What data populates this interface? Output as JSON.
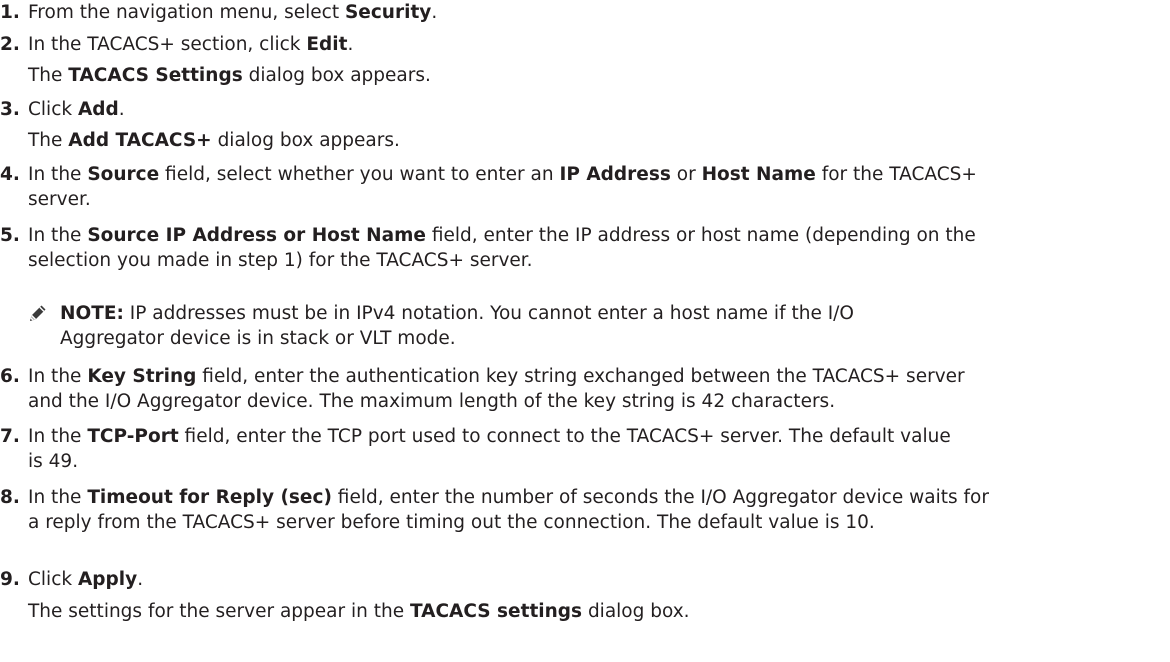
{
  "steps": [
    {
      "num": "1.",
      "t1": "From the navigation menu, select ",
      "b1": "Security",
      "t2": "."
    },
    {
      "num": "2.",
      "t1": "In the TACACS+ section, click ",
      "b1": "Edit",
      "t2": "."
    },
    {
      "num": "3.",
      "t1": "Click ",
      "b1": "Add",
      "t2": "."
    },
    {
      "num": "4.",
      "t1": "In the ",
      "b1": "Source",
      "t2": " field, select whether you want to enter an ",
      "b2": "IP Address",
      "t3": " or ",
      "b3": "Host Name",
      "t4": " for the TACACS+",
      "t5": "server."
    },
    {
      "num": "5.",
      "t1": "In the ",
      "b1": "Source IP Address or Host Name",
      "t2": " field, enter the IP address or host name (depending on the",
      "t3": "selection you made in step 1) for the TACACS+ server."
    },
    {
      "num": "6.",
      "t1": "In the ",
      "b1": "Key String",
      "t2": " field, enter the authentication key string exchanged between the TACACS+ server",
      "t3": "and the I/O Aggregator device. The maximum length of the key string is 42 characters."
    },
    {
      "num": "7.",
      "t1": "In the ",
      "b1": "TCP-Port",
      "t2": " field, enter the TCP port used to connect to the TACACS+ server. The default value",
      "t3": "is 49."
    },
    {
      "num": "8.",
      "t1": "In the ",
      "b1": "Timeout for Reply (sec)",
      "t2": " field, enter the number of seconds the I/O Aggregator device waits for",
      "t3": "a reply from the TACACS+ server before timing out the connection. The default value is 10."
    },
    {
      "num": "9.",
      "t1": "Click ",
      "b1": "Apply",
      "t2": "."
    }
  ],
  "results": {
    "r2": {
      "t1": "The ",
      "b1": "TACACS Settings",
      "t2": " dialog box appears."
    },
    "r3": {
      "t1": "The ",
      "b1": "Add TACACS+",
      "t2": " dialog box appears."
    },
    "r9": {
      "t1": "The settings for the server appear in the ",
      "b1": "TACACS settings",
      "t2": " dialog box."
    }
  },
  "note": {
    "icon": "pencil-note-icon",
    "label": "NOTE:",
    "line1": " IP addresses must be in IPv4 notation. You cannot enter a host name if the I/O",
    "line2": "Aggregator device is in stack or VLT mode."
  }
}
